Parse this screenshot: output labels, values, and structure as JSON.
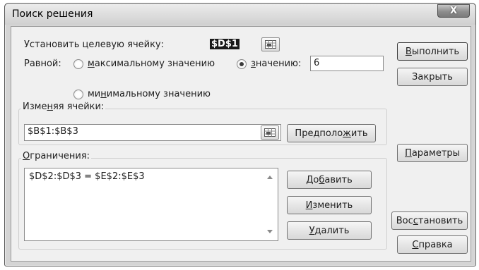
{
  "window": {
    "title": "Поиск решения",
    "close_label": "X"
  },
  "target": {
    "label_pre": "Установить целевую ячейку:",
    "value": "$D$1"
  },
  "equal": {
    "label": "Равной:",
    "max_pre": "",
    "max_accel": "м",
    "max_post": "аксимальному значению",
    "value_accel": "з",
    "value_post": "начению:",
    "value_input": "6",
    "min_pre": "ми",
    "min_accel": "н",
    "min_post": "имальному значению"
  },
  "changing": {
    "legend_pre": "Изме",
    "legend_accel": "н",
    "legend_post": "яя ячейки:",
    "value": "$B$1:$B$3",
    "guess_pre": "Предполо",
    "guess_accel": "ж",
    "guess_post": "ить"
  },
  "constraints": {
    "legend_accel": "О",
    "legend_post": "граничения:",
    "items": [
      "$D$2:$D$3 = $E$2:$E$3"
    ],
    "add_pre": "До",
    "add_accel": "б",
    "add_post": "авить",
    "edit_accel": "И",
    "edit_post": "зменить",
    "delete_accel": "У",
    "delete_post": "далить"
  },
  "buttons": {
    "solve_accel": "В",
    "solve_post": "ыполнить",
    "close": "Закрыть",
    "options_accel": "П",
    "options_post": "араметры",
    "reset_pre": "Вос",
    "reset_accel": "с",
    "reset_post": "тановить",
    "help_accel": "С",
    "help_post": "правка"
  },
  "icons": {
    "refedit": "range-select-icon",
    "close": "close-icon",
    "scroll_up": "scroll-up-icon",
    "scroll_down": "scroll-down-icon"
  }
}
